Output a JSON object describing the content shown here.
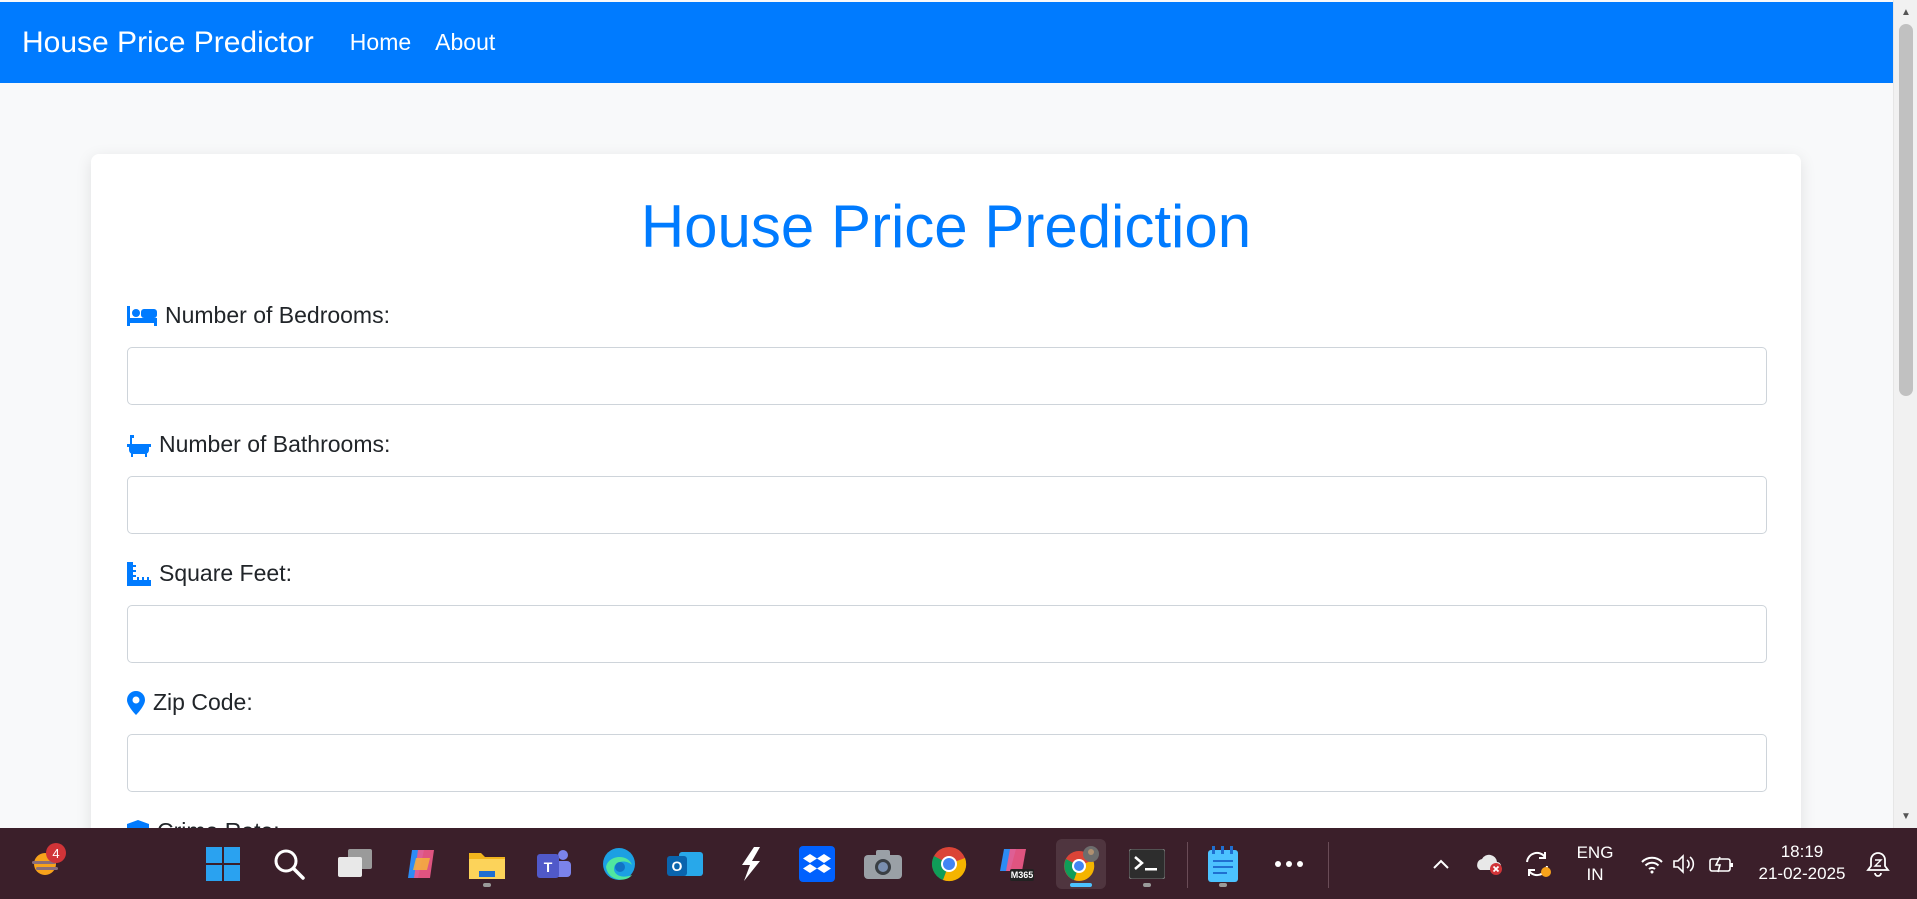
{
  "navbar": {
    "brand": "House Price Predictor",
    "links": [
      "Home",
      "About"
    ]
  },
  "form": {
    "title": "House Price Prediction",
    "fields": [
      {
        "label": "Number of Bedrooms:",
        "icon": "bed-icon",
        "value": ""
      },
      {
        "label": "Number of Bathrooms:",
        "icon": "bath-icon",
        "value": ""
      },
      {
        "label": "Square Feet:",
        "icon": "ruler-icon",
        "value": ""
      },
      {
        "label": "Zip Code:",
        "icon": "map-pin-icon",
        "value": ""
      },
      {
        "label": "Crime Rate:",
        "icon": "shield-icon",
        "value": ""
      }
    ]
  },
  "taskbar": {
    "weather_badge": "4",
    "apps": [
      "start",
      "search",
      "task-view",
      "copilot",
      "file-explorer",
      "teams",
      "edge",
      "outlook",
      "app-s",
      "dropbox",
      "camera",
      "chrome",
      "m365-copilot",
      "chrome-profile",
      "terminal",
      "notepad",
      "more"
    ],
    "tray": {
      "language_line1": "ENG",
      "language_line2": "IN",
      "time": "18:19",
      "date": "21-02-2025"
    }
  },
  "colors": {
    "primary": "#007bff",
    "taskbar": "#3b1f2a",
    "page_bg": "#f8f9fa"
  }
}
